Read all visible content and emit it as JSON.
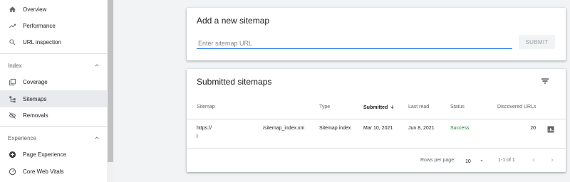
{
  "sidebar": {
    "top_items": [
      {
        "label": "Overview",
        "icon": "home-icon"
      },
      {
        "label": "Performance",
        "icon": "trending-up-icon"
      },
      {
        "label": "URL inspection",
        "icon": "search-icon"
      }
    ],
    "index_section": {
      "label": "Index",
      "items": [
        {
          "label": "Coverage",
          "icon": "coverage-icon"
        },
        {
          "label": "Sitemaps",
          "icon": "sitemap-icon",
          "active": true
        },
        {
          "label": "Removals",
          "icon": "eye-off-icon"
        }
      ]
    },
    "experience_section": {
      "label": "Experience",
      "items": [
        {
          "label": "Page Experience",
          "icon": "add-circle-icon"
        },
        {
          "label": "Core Web Vitals",
          "icon": "speed-icon"
        }
      ]
    }
  },
  "add_sitemap": {
    "title": "Add a new sitemap",
    "input_placeholder": "Enter sitemap URL",
    "input_value": "",
    "submit_label": "SUBMIT"
  },
  "submitted": {
    "title": "Submitted sitemaps",
    "columns": [
      "Sitemap",
      "Type",
      "Submitted",
      "Last read",
      "Status",
      "Discovered URLs"
    ],
    "rows": [
      {
        "sitemap_line1": "https://",
        "sitemap_line2": "l",
        "sitemap_suffix": "/sitemap_index.xm",
        "type": "Sitemap index",
        "submitted": "Mar 10, 2021",
        "last_read": "Jun 8, 2021",
        "status": "Success",
        "discovered_urls": "20"
      }
    ],
    "footer": {
      "rows_per_page_label": "Rows per page:",
      "rows_per_page_value": "10",
      "range": "1-1 of 1"
    }
  },
  "colors": {
    "accent": "#1a73e8",
    "success": "#188038",
    "background": "#f1f3f4"
  }
}
